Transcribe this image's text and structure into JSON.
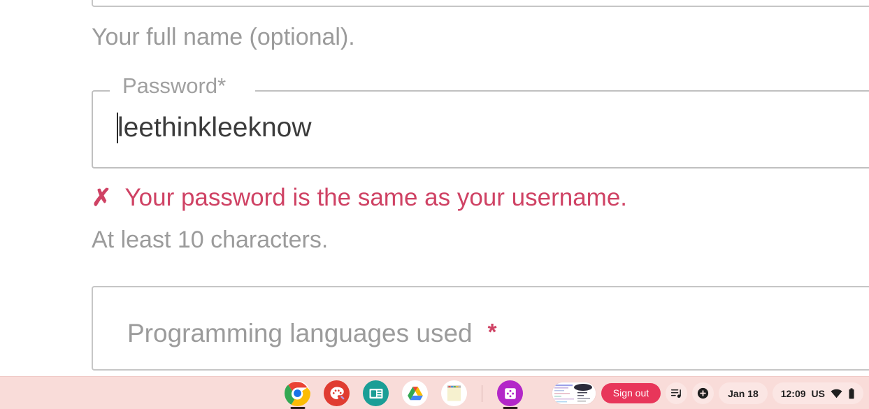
{
  "form": {
    "fullname_hint": "Your full name (optional).",
    "password_label": "Password*",
    "password_value": "leethinkleeknow",
    "error_icon": "x-mark",
    "error_message": "Your password is the same as your username.",
    "min_chars_hint": "At least 10 characters.",
    "languages_placeholder": "Programming languages used",
    "languages_required_mark": "*"
  },
  "colors": {
    "error": "#cf4264",
    "hint": "#9b9b9b",
    "input_text": "#3b3b3b",
    "field_border": "#c6c6c6",
    "shelf_bg": "#f9dcd9",
    "signout_bg": "#e8365a"
  },
  "shelf": {
    "apps": [
      {
        "name": "chrome",
        "label": "Google Chrome",
        "active": true
      },
      {
        "name": "canvas",
        "label": "Chrome Canvas",
        "active": false
      },
      {
        "name": "slides",
        "label": "Google Slides",
        "active": false
      },
      {
        "name": "drive",
        "label": "Google Drive",
        "active": false
      },
      {
        "name": "keep",
        "label": "Google Keep",
        "active": false
      },
      {
        "name": "game",
        "label": "Game",
        "active": true
      }
    ],
    "window_preview_label": "window-preview",
    "signout_label": "Sign out",
    "media_icon": "playlist-music-icon",
    "add_icon": "plus-circle-icon",
    "date": "Jan 18",
    "time": "12:09",
    "locale": "US",
    "wifi_icon": "wifi-icon",
    "battery_icon": "battery-icon"
  }
}
